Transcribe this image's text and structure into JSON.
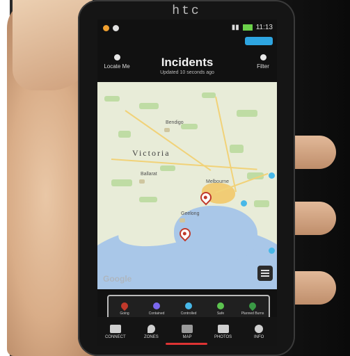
{
  "device": {
    "brand": "htc"
  },
  "status": {
    "time": "11:13"
  },
  "header": {
    "title": "Incidents",
    "subtitle": "Updated 10 seconds ago",
    "left_label": "Locate Me",
    "right_label": "Filter"
  },
  "map": {
    "region_label": "Victoria",
    "labels": [
      "Bendigo",
      "Ballarat",
      "Melbourne",
      "Geelong"
    ],
    "attribution": "Google",
    "pins": [
      {
        "type": "going",
        "icon": "fire-icon"
      },
      {
        "type": "going",
        "icon": "fire-icon"
      },
      {
        "type": "controlled",
        "icon": "dot-icon"
      }
    ]
  },
  "legend": [
    {
      "label": "Going",
      "color": "#c0392b",
      "icon": "flame-icon"
    },
    {
      "label": "Contained",
      "color": "#7b68ee",
      "icon": "dot-icon"
    },
    {
      "label": "Controlled",
      "color": "#47b8e8",
      "icon": "dot-icon"
    },
    {
      "label": "Safe",
      "color": "#5cc34f",
      "icon": "dot-icon"
    },
    {
      "label": "Planned Burns",
      "color": "#3a9a45",
      "icon": "flame-icon"
    }
  ],
  "nav": [
    {
      "label": "CONNECT",
      "icon": "grid-icon"
    },
    {
      "label": "ZONES",
      "icon": "location-icon"
    },
    {
      "label": "MAP",
      "icon": "map-icon",
      "active": true
    },
    {
      "label": "PHOTOS",
      "icon": "camera-icon"
    },
    {
      "label": "INFO",
      "icon": "info-icon"
    }
  ]
}
